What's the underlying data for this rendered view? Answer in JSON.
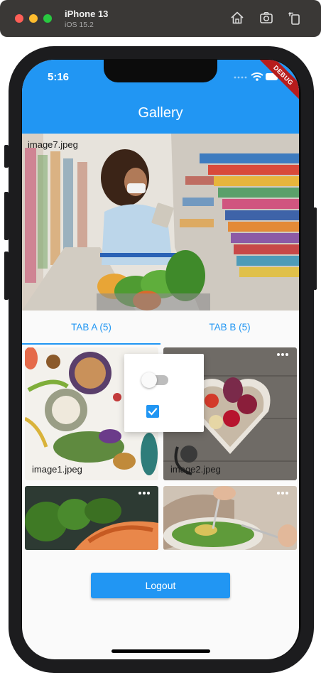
{
  "simulator": {
    "device_name": "iPhone 13",
    "os_version": "iOS 15.2",
    "toolbar_icons": [
      "home-icon",
      "screenshot-icon",
      "rotate-icon"
    ]
  },
  "status_bar": {
    "time": "5:16",
    "icons": [
      "signal-icon",
      "wifi-icon",
      "battery-icon"
    ]
  },
  "debug_banner": "DEBUG",
  "app_bar": {
    "title": "Gallery"
  },
  "hero": {
    "caption": "image7.jpeg"
  },
  "tabs": [
    {
      "label": "TAB A (5)",
      "selected": true
    },
    {
      "label": "TAB B (5)",
      "selected": false
    }
  ],
  "grid": [
    {
      "caption": "image1.jpeg",
      "has_menu": false
    },
    {
      "caption": "image2.jpeg",
      "has_menu": true
    },
    {
      "caption": "",
      "has_menu": true
    },
    {
      "caption": "",
      "has_menu": true
    }
  ],
  "popup_menu": {
    "switch_on": false,
    "checkbox_checked": true
  },
  "logout_label": "Logout",
  "colors": {
    "primary": "#2196f3",
    "debug_banner": "#b71c1c",
    "background": "#fafafa"
  }
}
